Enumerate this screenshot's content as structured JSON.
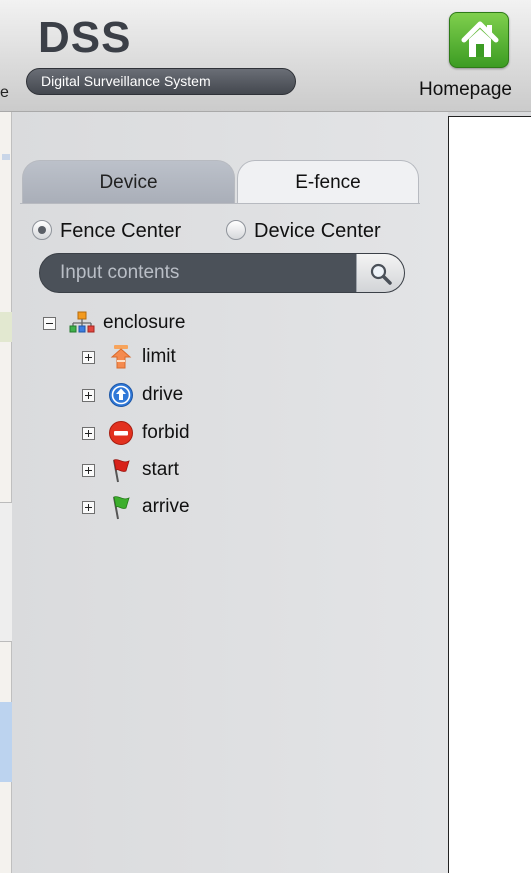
{
  "header": {
    "logo": "DSS",
    "subtitle": "Digital Surveillance System",
    "edge_letter": "e",
    "home_label": "Homepage",
    "home_icon": "house-icon",
    "accent_green": "#4caf2a"
  },
  "tabs": [
    {
      "label": "Device",
      "active": false
    },
    {
      "label": "E-fence",
      "active": true
    }
  ],
  "radios": {
    "fence_center": {
      "label": "Fence Center",
      "checked": true
    },
    "device_center": {
      "label": "Device Center",
      "checked": false
    }
  },
  "search": {
    "placeholder": "Input contents",
    "value": "",
    "icon": "magnifier-icon"
  },
  "tree": {
    "root": {
      "label": "enclosure",
      "icon": "network-icon",
      "expanded": true
    },
    "children": [
      {
        "label": "limit",
        "icon": "speed-limit-icon",
        "expanded": false
      },
      {
        "label": "drive",
        "icon": "arrow-up-circle-icon",
        "expanded": false
      },
      {
        "label": "forbid",
        "icon": "no-entry-icon",
        "expanded": false
      },
      {
        "label": "start",
        "icon": "red-flag-icon",
        "expanded": false
      },
      {
        "label": "arrive",
        "icon": "green-flag-icon",
        "expanded": false
      }
    ]
  }
}
